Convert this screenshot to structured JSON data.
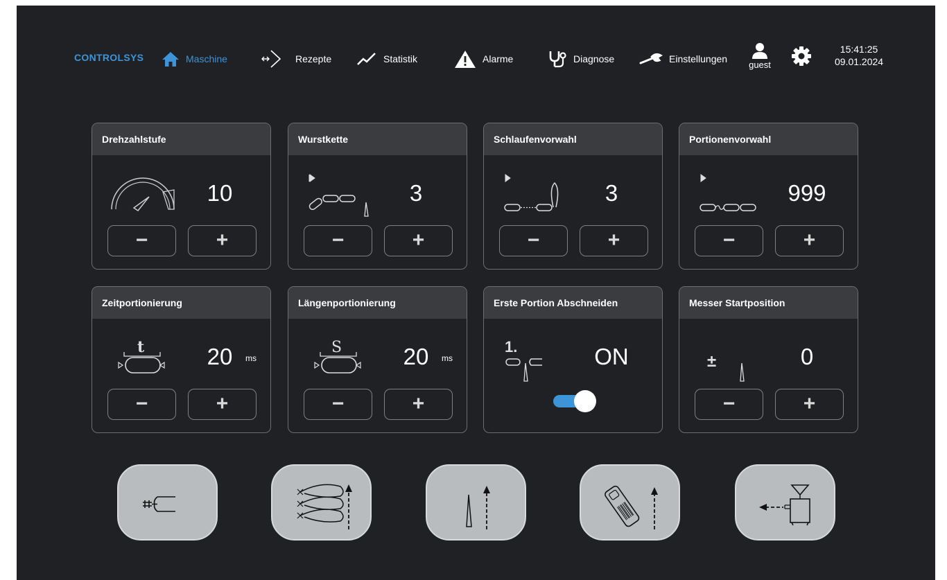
{
  "app": {
    "brand": "CONTROLSYS"
  },
  "nav": {
    "items": [
      {
        "label": "Maschine",
        "icon": "home-icon",
        "active": true
      },
      {
        "label": "Rezepte",
        "icon": "recipe-arrows-icon"
      },
      {
        "label": "Statistik",
        "icon": "trend-line-icon"
      },
      {
        "label": "Alarme",
        "icon": "warning-icon"
      },
      {
        "label": "Diagnose",
        "icon": "stethoscope-icon"
      },
      {
        "label": "Einstellungen",
        "icon": "wrench-icon"
      }
    ],
    "user": {
      "label": "guest",
      "icon": "user-icon"
    },
    "settings_icon": "gear-icon",
    "time": "15:41:25",
    "date": "09.01.2024"
  },
  "cards": [
    {
      "title": "Drehzahlstufe",
      "value": "10",
      "unit": "",
      "icon": "speedometer-icon"
    },
    {
      "title": "Wurstkette",
      "value": "3",
      "unit": "",
      "icon": "sausage-chain-icon"
    },
    {
      "title": "Schlaufenvorwahl",
      "value": "3",
      "unit": "",
      "icon": "loop-chain-icon"
    },
    {
      "title": "Portionenvorwahl",
      "value": "999",
      "unit": "",
      "icon": "portion-chain-icon"
    },
    {
      "title": "Zeitportionierung",
      "value": "20",
      "unit": "ms",
      "icon": "time-portion-icon"
    },
    {
      "title": "Längenportionierung",
      "value": "20",
      "unit": "ms",
      "icon": "length-portion-icon"
    },
    {
      "title": "Erste Portion Abschneiden",
      "value": "ON",
      "unit": "",
      "icon": "first-portion-cut-icon",
      "toggle": true
    },
    {
      "title": "Messer Startposition",
      "value": "0",
      "unit": "",
      "icon": "knife-position-icon"
    }
  ],
  "buttons": {
    "minus": "−",
    "plus": "+"
  },
  "bottom_buttons": [
    {
      "icon": "casing-fill-icon"
    },
    {
      "icon": "loops-up-icon"
    },
    {
      "icon": "knife-up-icon"
    },
    {
      "icon": "scanner-up-icon"
    },
    {
      "icon": "hopper-eject-icon"
    }
  ],
  "colors": {
    "accent": "#3d94d9",
    "background": "#1f2124",
    "card_header": "#3a3c40",
    "bottom_button": "#b9bcbf"
  }
}
